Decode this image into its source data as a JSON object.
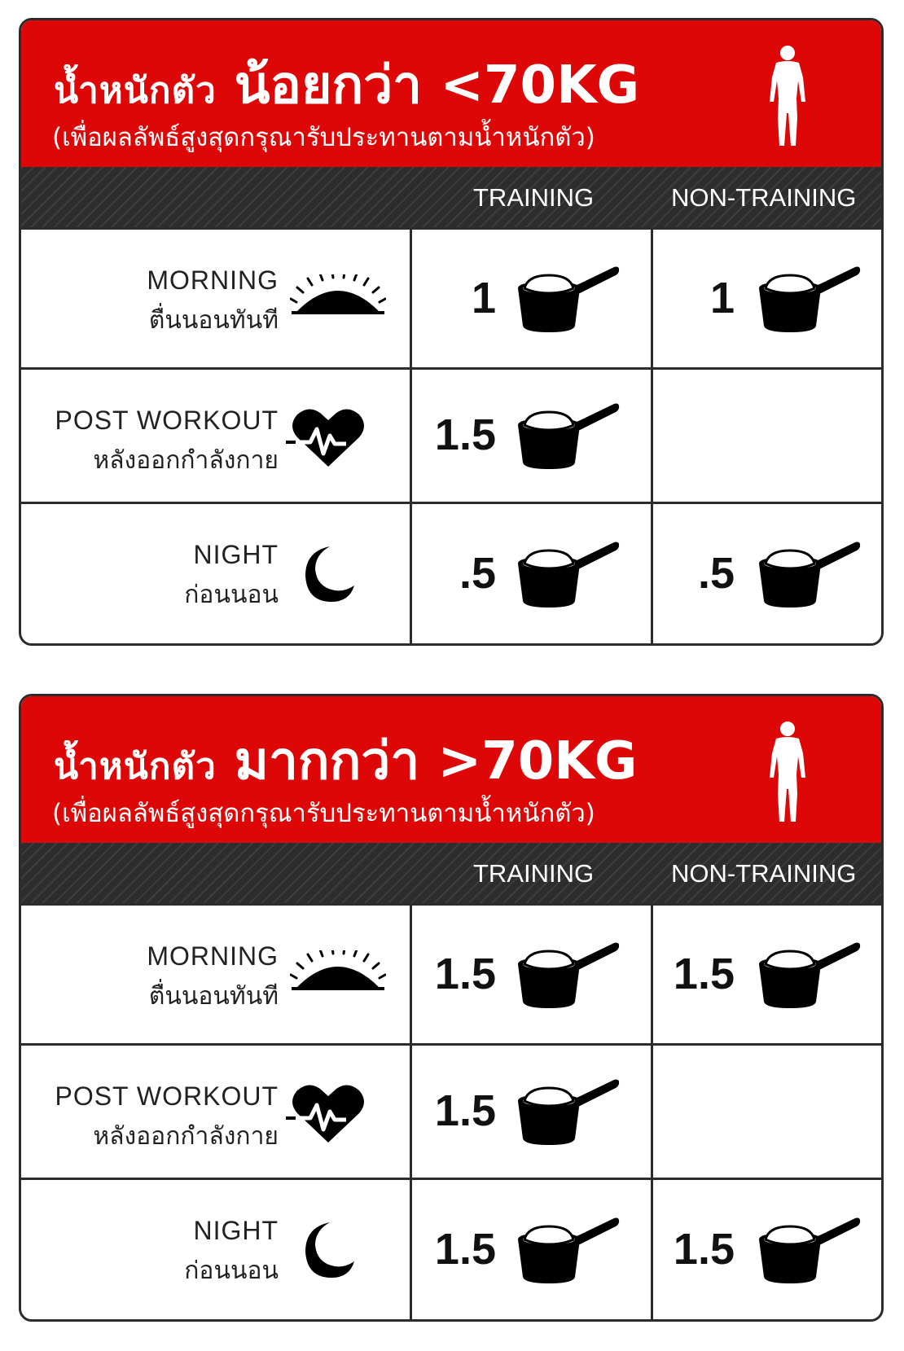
{
  "columns": {
    "training": "TRAINING",
    "non_training": "NON-TRAINING"
  },
  "tables": [
    {
      "weight_label": "น้ำหนักตัว",
      "condition": "น้อยกว่า <70KG",
      "subtitle": "(เพื่อผลลัพธ์สูงสุดกรุณารับประทานตามน้ำหนักตัว)",
      "rows": [
        {
          "label_en": "MORNING",
          "label_th": "ตื่นนอนทันที",
          "icon": "sunrise-icon",
          "training": "1",
          "non_training": "1"
        },
        {
          "label_en": "POST WORKOUT",
          "label_th": "หลังออกกำลังกาย",
          "icon": "heartbeat-icon",
          "training": "1.5",
          "non_training": ""
        },
        {
          "label_en": "NIGHT",
          "label_th": "ก่อนนอน",
          "icon": "moon-icon",
          "training": ".5",
          "non_training": ".5"
        }
      ]
    },
    {
      "weight_label": "น้ำหนักตัว",
      "condition": "มากกว่า >70KG",
      "subtitle": "(เพื่อผลลัพธ์สูงสุดกรุณารับประทานตามน้ำหนักตัว)",
      "rows": [
        {
          "label_en": "MORNING",
          "label_th": "ตื่นนอนทันที",
          "icon": "sunrise-icon",
          "training": "1.5",
          "non_training": "1.5"
        },
        {
          "label_en": "POST WORKOUT",
          "label_th": "หลังออกกำลังกาย",
          "icon": "heartbeat-icon",
          "training": "1.5",
          "non_training": ""
        },
        {
          "label_en": "NIGHT",
          "label_th": "ก่อนนอน",
          "icon": "moon-icon",
          "training": "1.5",
          "non_training": "1.5"
        }
      ]
    }
  ],
  "colors": {
    "header_red": "#dd0707",
    "stripe_dark": "#2d2d2d",
    "border": "#2c2c2c"
  }
}
